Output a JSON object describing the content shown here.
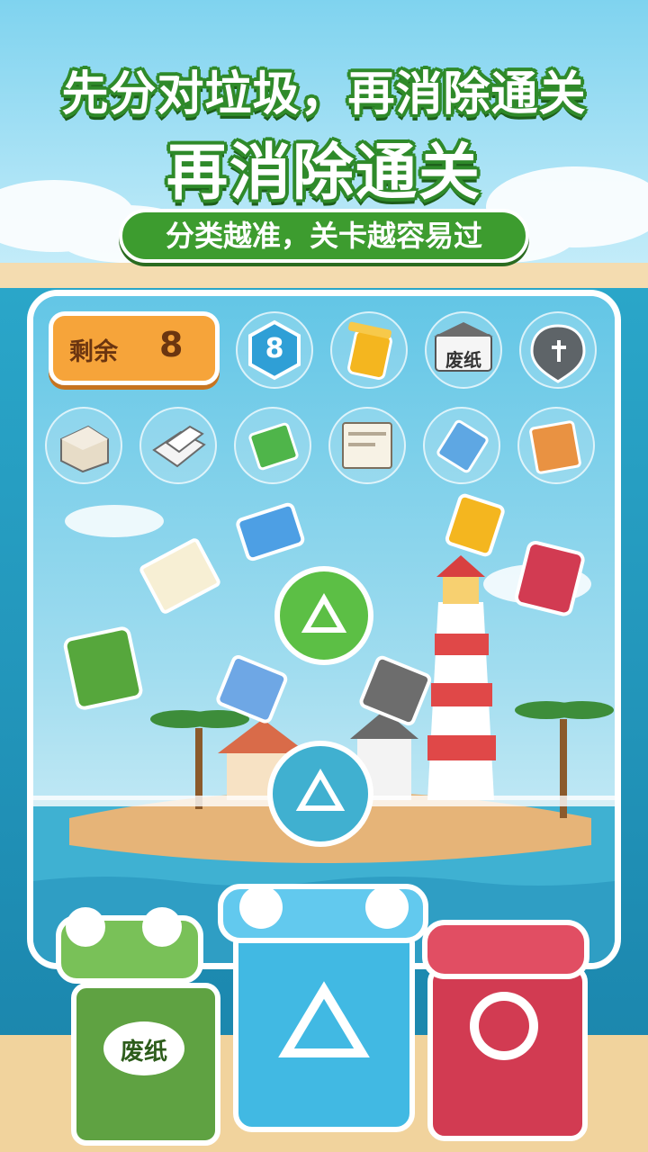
{
  "headline": {
    "line1": "先分对垃圾，再消除通关",
    "line2": "再消除通关"
  },
  "subtitle": "分类越准，关卡越容易过",
  "counter": {
    "label": "剩余",
    "value": "8"
  },
  "top_row": {
    "count_badge": "8",
    "waste_paper_tag": "废纸"
  },
  "mascots": {
    "left_bin_label": "废纸"
  },
  "colors": {
    "title_green": "#2f8a2a",
    "pill_green": "#3d9c2f",
    "counter_orange": "#f6a43a",
    "bin_blue": "#41b9e3",
    "bin_green": "#56a73c",
    "bin_red": "#d23b52",
    "bin_yellow": "#f4b61f"
  },
  "icons": [
    "recycle-icon",
    "yellow-bin-icon",
    "paper-box-icon",
    "folded-paper-icon",
    "green-card-icon",
    "receipt-icon",
    "blue-carton-icon",
    "orange-box-icon",
    "document-icon",
    "green-bin-icon",
    "red-bin-icon",
    "lighthouse-icon",
    "palm-tree-icon",
    "frog-bin-mascot-icon",
    "blue-bin-mascot-icon",
    "red-bin-mascot-icon"
  ]
}
